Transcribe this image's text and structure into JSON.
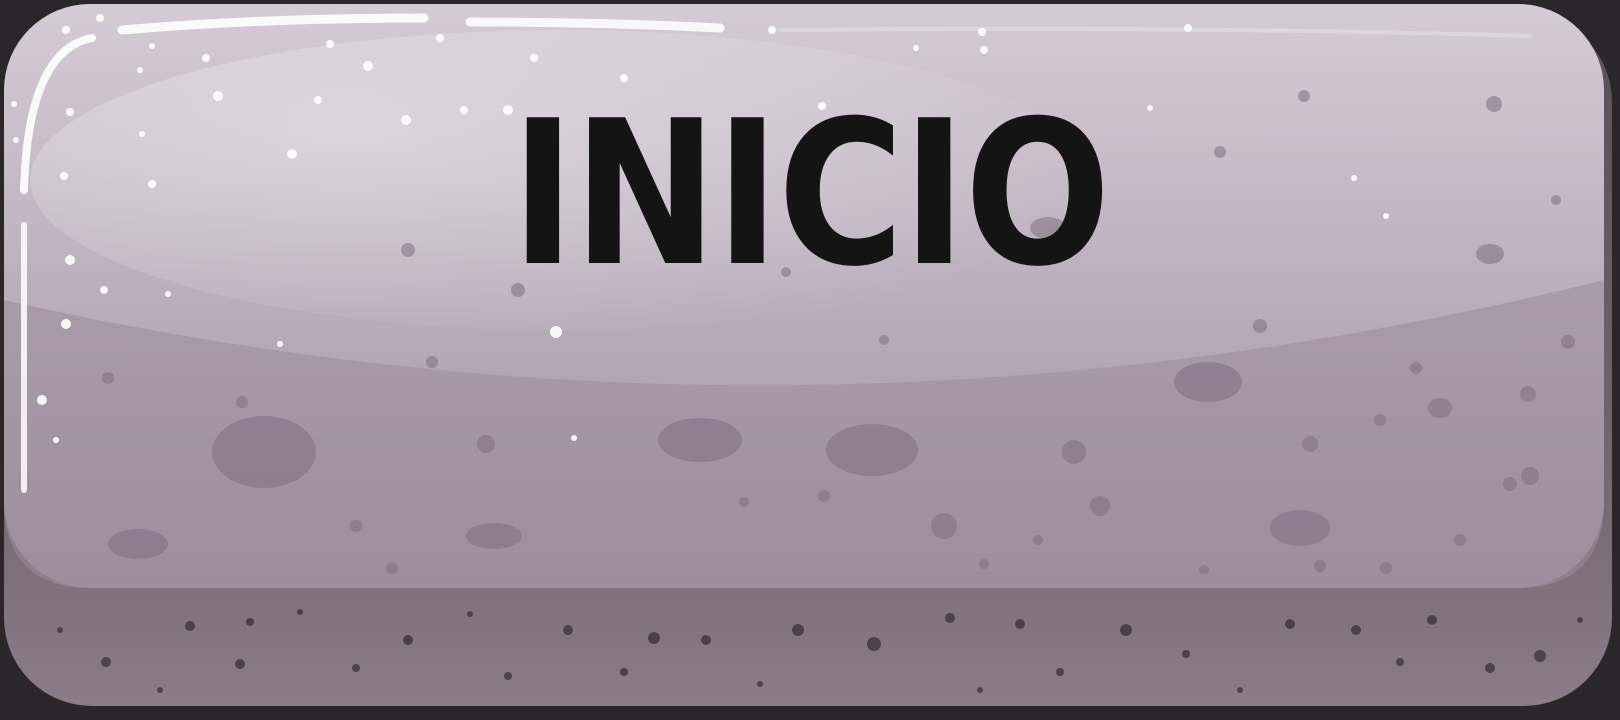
{
  "button": {
    "label": "INICIO",
    "icon": "stone-texture-button",
    "colors": {
      "face_light": "#d8cfd8",
      "face_mid": "#b7abb8",
      "face_dark": "#9a8c9b",
      "base_light": "#8a7c88",
      "base_dark": "#4d444b",
      "label": "#141414",
      "border": "#2a2629"
    }
  }
}
